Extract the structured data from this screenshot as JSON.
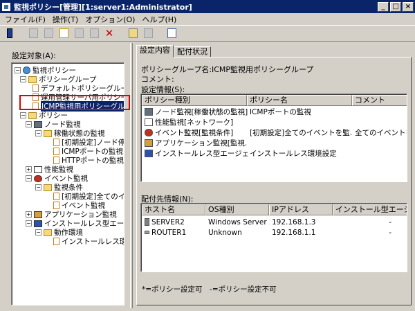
{
  "window": {
    "title": "監視ポリシー[管理][1:server1:Administrator]"
  },
  "menu": [
    "ファイル(F)",
    "操作(T)",
    "オプション(O)",
    "ヘルプ(H)"
  ],
  "left": {
    "label": "設定対象(A):",
    "tree": [
      {
        "label": "監視ポリシー"
      },
      {
        "label": "ポリシーグループ"
      },
      {
        "label": "デフォルトポリシーグループ"
      },
      {
        "label": "運用管理サーバ用ポリシー"
      },
      {
        "label": "ICMP監視用ポリシーグループ"
      },
      {
        "label": "ポリシー"
      },
      {
        "label": "ノード監視"
      },
      {
        "label": "稼働状態の監視"
      },
      {
        "label": "[初期設定]ノード停"
      },
      {
        "label": "ICMPポートの監視"
      },
      {
        "label": "HTTPポートの監視"
      },
      {
        "label": "性能監視"
      },
      {
        "label": "イベント監視"
      },
      {
        "label": "監視条件"
      },
      {
        "label": "[初期設定]全てのイ"
      },
      {
        "label": "イベント監視"
      },
      {
        "label": "アプリケーション監視"
      },
      {
        "label": "インストールレス型エージ"
      },
      {
        "label": "動作環境"
      },
      {
        "label": "インストールレス環"
      }
    ]
  },
  "tabs": [
    "設定内容",
    "配付状況"
  ],
  "detail": {
    "group_name_label": "ポリシーグループ名:",
    "group_name_value": "ICMP監視用ポリシーグループ",
    "comment_label": "コメント:",
    "settings_label": "設定情報(S):",
    "policy_columns": [
      "ポリシー種別",
      "ポリシー名",
      "コメント"
    ],
    "policy_rows": [
      {
        "type": "ノード監視[稼働状態の監視]",
        "name": "ICMPポートの監視",
        "comment": ""
      },
      {
        "type": "性能監視[ネットワーク]",
        "name": "",
        "comment": ""
      },
      {
        "type": "イベント監視[監視条件]",
        "name": "[初期設定]全てのイベントを監...",
        "comment": "全てのイベントを"
      },
      {
        "type": "アプリケーション監視[監視...",
        "name": "",
        "comment": ""
      },
      {
        "type": "インストールレス型エージェ...",
        "name": "インストールレス環境設定",
        "comment": ""
      }
    ],
    "dist_label": "配付先情報(N):",
    "dist_columns": [
      "ホスト名",
      "OS種別",
      "IPアドレス",
      "インストール型エージェ"
    ],
    "dist_rows": [
      {
        "host": "SERVER2",
        "os": "Windows Server 2003",
        "ip": "192.168.1.3",
        "agent": "-"
      },
      {
        "host": "ROUTER1",
        "os": "Unknown",
        "ip": "192.168.1.1",
        "agent": "-"
      }
    ],
    "note": "*=ポリシー設定可　-=ポリシー設定不可"
  }
}
